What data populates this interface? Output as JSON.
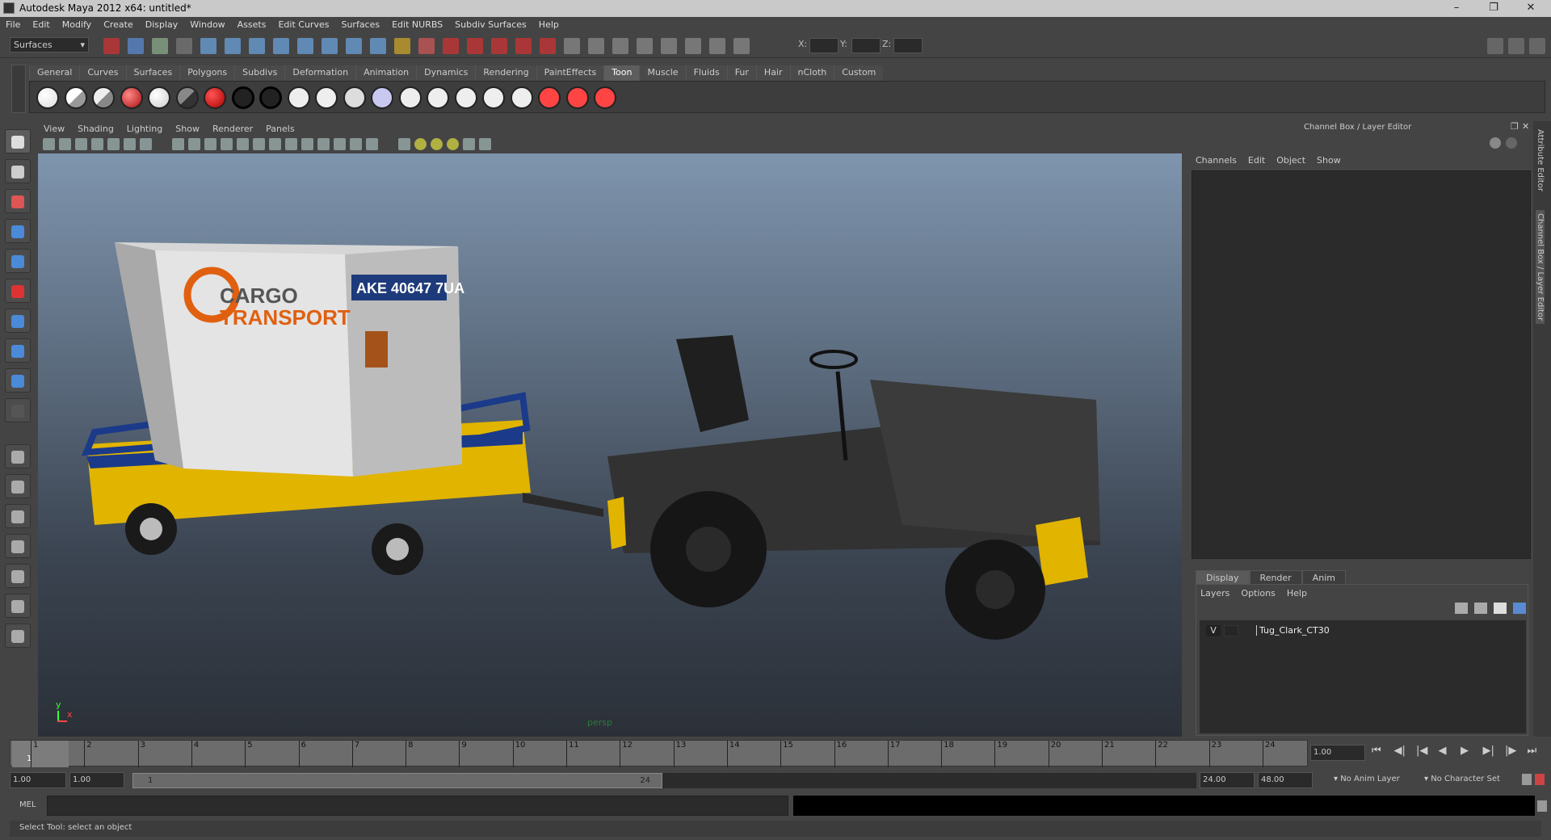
{
  "window": {
    "title": "Autodesk Maya 2012 x64: untitled*"
  },
  "menubar": [
    "File",
    "Edit",
    "Modify",
    "Create",
    "Display",
    "Window",
    "Assets",
    "Edit Curves",
    "Surfaces",
    "Edit NURBS",
    "Subdiv Surfaces",
    "Help"
  ],
  "toolbar": {
    "menuset": "Surfaces",
    "x_label": "X:",
    "y_label": "Y:",
    "z_label": "Z:"
  },
  "shelf_tabs": [
    "General",
    "Curves",
    "Surfaces",
    "Polygons",
    "Subdivs",
    "Deformation",
    "Animation",
    "Dynamics",
    "Rendering",
    "PaintEffects",
    "Toon",
    "Muscle",
    "Fluids",
    "Fur",
    "Hair",
    "nCloth",
    "Custom"
  ],
  "shelf_active": "Toon",
  "viewport": {
    "menu": [
      "View",
      "Shading",
      "Lighting",
      "Show",
      "Renderer",
      "Panels"
    ],
    "camera_label": "persp",
    "axis_x": "x",
    "axis_y": "y",
    "cargo_label": "AKE 40647 7UA",
    "cargo_brand_1": "CARGO",
    "cargo_brand_2": "TRANSPORT"
  },
  "channel_box": {
    "title": "Channel Box / Layer Editor",
    "menu": [
      "Channels",
      "Edit",
      "Object",
      "Show"
    ]
  },
  "layer_editor": {
    "tabs": [
      "Display",
      "Render",
      "Anim"
    ],
    "active_tab": "Display",
    "menu": [
      "Layers",
      "Options",
      "Help"
    ],
    "layers": [
      {
        "visible": "V",
        "name": "Tug_Clark_CT30"
      }
    ]
  },
  "side_tabs": [
    "Attribute Editor",
    "Channel Box / Layer Editor"
  ],
  "timeline": {
    "ticks": [
      1,
      2,
      3,
      4,
      5,
      6,
      7,
      8,
      9,
      10,
      11,
      12,
      13,
      14,
      15,
      16,
      17,
      18,
      19,
      20,
      21,
      22,
      23,
      24
    ],
    "current_frame": "1",
    "current_time": "1.00"
  },
  "range": {
    "start": "1.00",
    "playback_start": "1.00",
    "bar_start": "1",
    "bar_end": "24",
    "playback_end": "24.00",
    "end": "48.00",
    "anim_layer": "No Anim Layer",
    "character_set": "No Character Set"
  },
  "mel": {
    "label": "MEL"
  },
  "status": "Select Tool: select an object"
}
